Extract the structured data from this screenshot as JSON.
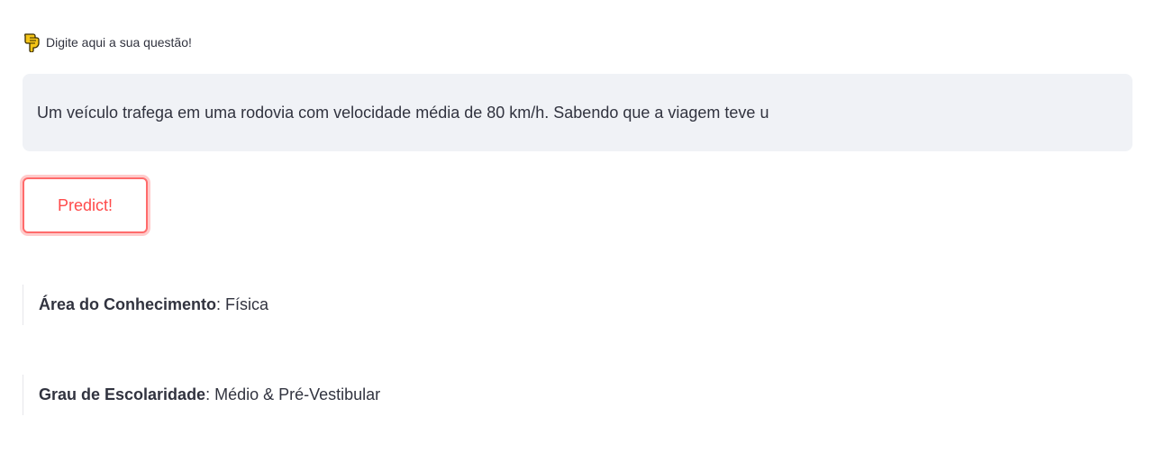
{
  "question_label": {
    "icon": "pointing-down-hand-icon",
    "text": "Digite aqui a sua questão!"
  },
  "question_input": {
    "value": "Um veículo trafega em uma rodovia com velocidade média de 80 km/h. Sabendo que a viagem teve u"
  },
  "predict_button": {
    "label": "Predict!"
  },
  "results": {
    "area": {
      "label": "Área do Conhecimento",
      "separator": ": ",
      "value": "Física"
    },
    "grau": {
      "label": "Grau de Escolaridade",
      "separator": ": ",
      "value": "Médio & Pré-Vestibular"
    }
  },
  "colors": {
    "accent": "#ff4b4b",
    "input_bg": "#f0f2f6",
    "text": "#31333f",
    "icon_fill": "#f5c518"
  }
}
